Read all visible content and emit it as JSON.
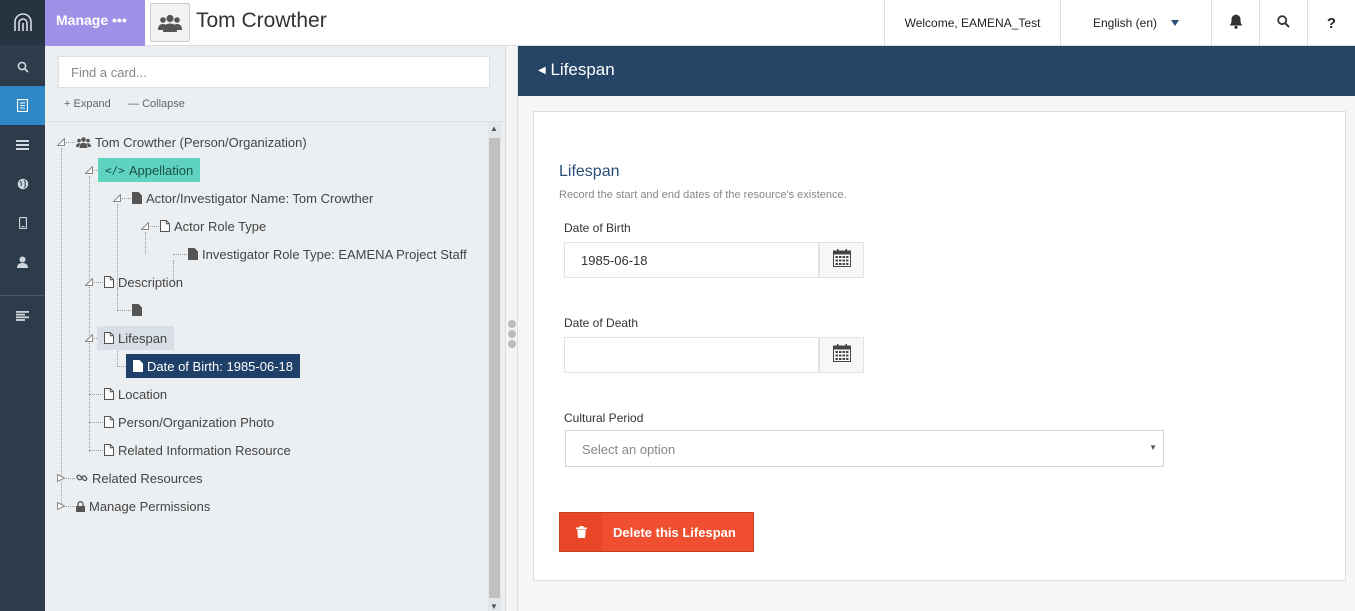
{
  "topbar": {
    "manage_label": "Manage •••",
    "resource_title": "Tom Crowther",
    "welcome": "Welcome, EAMENA_Test",
    "language": "English (en)",
    "help": "?"
  },
  "rail": {
    "icons": [
      "arches-logo-icon",
      "search-icon",
      "resource-editor-icon",
      "list-icon",
      "globe-icon",
      "mobile-icon",
      "user-icon",
      "align-left-icon"
    ],
    "active": "resource-editor-icon"
  },
  "tree": {
    "search_placeholder": "Find a card...",
    "expand_label": "Expand",
    "collapse_label": "Collapse",
    "nodes": {
      "root": "Tom Crowther (Person/Organization)",
      "appellation": "Appellation",
      "actor_name": "Actor/Investigator Name: Tom Crowther",
      "actor_role_type": "Actor Role Type",
      "investigator_role": "Investigator Role Type: EAMENA Project Staff",
      "description": "Description",
      "description_child": "",
      "lifespan": "Lifespan",
      "date_of_birth": "Date of Birth: 1985-06-18",
      "location": "Location",
      "photo": "Person/Organization Photo",
      "related_info": "Related Information Resource",
      "related_resources": "Related Resources",
      "manage_permissions": "Manage Permissions"
    }
  },
  "form": {
    "header": "Lifespan",
    "card_title": "Lifespan",
    "card_subtitle": "Record the start and end dates of the resource's existence.",
    "dob_label": "Date of Birth",
    "dob_value": "1985-06-18",
    "dod_label": "Date of Death",
    "dod_value": "",
    "period_label": "Cultural Period",
    "period_placeholder": "Select an option",
    "delete_label": "Delete this Lifespan"
  },
  "colors": {
    "rail_bg": "#2d3c4b",
    "rail_active": "#2f87c8",
    "manage_bg": "#9d91e8",
    "header_bg": "#254466",
    "appellation_highlight": "#5ed3c0",
    "selected_node": "#1f4068",
    "delete_button": "#f0502f"
  }
}
